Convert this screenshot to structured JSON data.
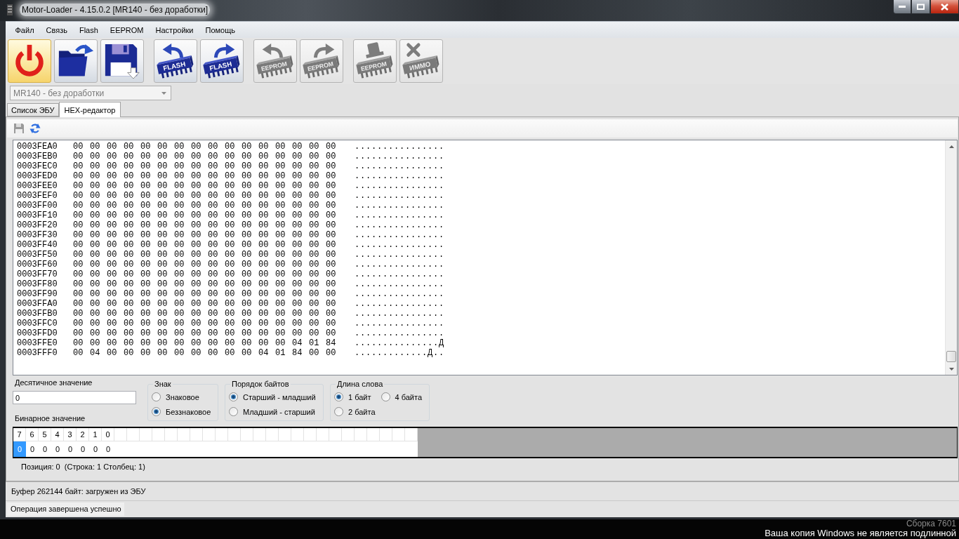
{
  "window": {
    "title": "Motor-Loader - 4.15.0.2 [MR140 - без доработки]"
  },
  "menu": [
    "Файл",
    "Связь",
    "Flash",
    "EEPROM",
    "Настройки",
    "Помощь"
  ],
  "toolbar": [
    [
      {
        "kind": "power",
        "highlighted": true,
        "disabled": false
      },
      {
        "kind": "open",
        "highlighted": false,
        "disabled": false
      },
      {
        "kind": "save",
        "highlighted": false,
        "disabled": false
      }
    ],
    [
      {
        "kind": "chip-read",
        "chip_label": "FLASH",
        "highlighted": false,
        "disabled": false
      },
      {
        "kind": "chip-write",
        "chip_label": "FLASH",
        "highlighted": false,
        "disabled": false
      }
    ],
    [
      {
        "kind": "chip-read",
        "chip_label": "EEPROM",
        "highlighted": false,
        "disabled": true
      },
      {
        "kind": "chip-write",
        "chip_label": "EEPROM",
        "highlighted": false,
        "disabled": true
      }
    ],
    [
      {
        "kind": "chip-stamp",
        "chip_label": "EEPROM",
        "highlighted": false,
        "disabled": true
      },
      {
        "kind": "chip-cross",
        "chip_label": "ИММО",
        "highlighted": false,
        "disabled": true
      }
    ]
  ],
  "ecu_select": {
    "value": "MR140 - без доработки",
    "disabled": true
  },
  "tabs": [
    {
      "label": "Список ЭБУ",
      "selected": false
    },
    {
      "label": "HEX-редактор",
      "selected": true
    }
  ],
  "editor_toolbar": [
    {
      "kind": "save",
      "disabled": true
    },
    {
      "kind": "refresh",
      "disabled": false
    }
  ],
  "hex_view": {
    "rows": [
      {
        "address": "0003FEA0",
        "bytes": "00 00 00 00 00 00 00 00 00 00 00 00 00 00 00 00",
        "ascii": "................"
      },
      {
        "address": "0003FEB0",
        "bytes": "00 00 00 00 00 00 00 00 00 00 00 00 00 00 00 00",
        "ascii": "................"
      },
      {
        "address": "0003FEC0",
        "bytes": "00 00 00 00 00 00 00 00 00 00 00 00 00 00 00 00",
        "ascii": "................"
      },
      {
        "address": "0003FED0",
        "bytes": "00 00 00 00 00 00 00 00 00 00 00 00 00 00 00 00",
        "ascii": "................"
      },
      {
        "address": "0003FEE0",
        "bytes": "00 00 00 00 00 00 00 00 00 00 00 00 00 00 00 00",
        "ascii": "................"
      },
      {
        "address": "0003FEF0",
        "bytes": "00 00 00 00 00 00 00 00 00 00 00 00 00 00 00 00",
        "ascii": "................"
      },
      {
        "address": "0003FF00",
        "bytes": "00 00 00 00 00 00 00 00 00 00 00 00 00 00 00 00",
        "ascii": "................"
      },
      {
        "address": "0003FF10",
        "bytes": "00 00 00 00 00 00 00 00 00 00 00 00 00 00 00 00",
        "ascii": "................"
      },
      {
        "address": "0003FF20",
        "bytes": "00 00 00 00 00 00 00 00 00 00 00 00 00 00 00 00",
        "ascii": "................"
      },
      {
        "address": "0003FF30",
        "bytes": "00 00 00 00 00 00 00 00 00 00 00 00 00 00 00 00",
        "ascii": "................"
      },
      {
        "address": "0003FF40",
        "bytes": "00 00 00 00 00 00 00 00 00 00 00 00 00 00 00 00",
        "ascii": "................"
      },
      {
        "address": "0003FF50",
        "bytes": "00 00 00 00 00 00 00 00 00 00 00 00 00 00 00 00",
        "ascii": "................"
      },
      {
        "address": "0003FF60",
        "bytes": "00 00 00 00 00 00 00 00 00 00 00 00 00 00 00 00",
        "ascii": "................"
      },
      {
        "address": "0003FF70",
        "bytes": "00 00 00 00 00 00 00 00 00 00 00 00 00 00 00 00",
        "ascii": "................"
      },
      {
        "address": "0003FF80",
        "bytes": "00 00 00 00 00 00 00 00 00 00 00 00 00 00 00 00",
        "ascii": "................"
      },
      {
        "address": "0003FF90",
        "bytes": "00 00 00 00 00 00 00 00 00 00 00 00 00 00 00 00",
        "ascii": "................"
      },
      {
        "address": "0003FFA0",
        "bytes": "00 00 00 00 00 00 00 00 00 00 00 00 00 00 00 00",
        "ascii": "................"
      },
      {
        "address": "0003FFB0",
        "bytes": "00 00 00 00 00 00 00 00 00 00 00 00 00 00 00 00",
        "ascii": "................"
      },
      {
        "address": "0003FFC0",
        "bytes": "00 00 00 00 00 00 00 00 00 00 00 00 00 00 00 00",
        "ascii": "................"
      },
      {
        "address": "0003FFD0",
        "bytes": "00 00 00 00 00 00 00 00 00 00 00 00 00 00 00 00",
        "ascii": "................"
      },
      {
        "address": "0003FFE0",
        "bytes": "00 00 00 00 00 00 00 00 00 00 00 00 00 04 01 84",
        "ascii": "...............Д"
      },
      {
        "address": "0003FFF0",
        "bytes": "00 04 00 00 00 00 00 00 00 00 00 04 01 84 00 00",
        "ascii": ".............Д.."
      }
    ]
  },
  "value_panel": {
    "decimal": {
      "label": "Десятичное значение",
      "value": "0"
    },
    "option_groups": [
      {
        "title": "Знак",
        "rows": [
          [
            {
              "label": "Знаковое",
              "selected": false
            }
          ],
          [
            {
              "label": "Беззнаковое",
              "selected": true
            }
          ]
        ]
      },
      {
        "title": "Порядок байтов",
        "rows": [
          [
            {
              "label": "Старший - младший",
              "selected": true
            }
          ],
          [
            {
              "label": "Младший - старший",
              "selected": false
            }
          ]
        ]
      },
      {
        "title": "Длина слова",
        "rows": [
          [
            {
              "label": "1 байт",
              "selected": true
            },
            {
              "label": "4 байта",
              "selected": false
            }
          ],
          [
            {
              "label": "2 байта",
              "selected": false
            }
          ]
        ]
      }
    ],
    "binary": {
      "label": "Бинарное значение",
      "bits": [
        "7",
        "6",
        "5",
        "4",
        "3",
        "2",
        "1",
        "0"
      ],
      "values": [
        {
          "text": "0",
          "selected": true
        },
        {
          "text": "0",
          "selected": false
        },
        {
          "text": "0",
          "selected": false
        },
        {
          "text": "0",
          "selected": false
        },
        {
          "text": "0",
          "selected": false
        },
        {
          "text": "0",
          "selected": false
        },
        {
          "text": "0",
          "selected": false
        },
        {
          "text": "0",
          "selected": false
        }
      ]
    },
    "position": "Позиция: 0  (Строка: 1 Столбец: 1)"
  },
  "buffer_status": "Буфер 262144 байт: загружен из ЭБУ",
  "status_bar": "Операция завершена успешно",
  "desktop_text": [
    "Сборка 7601",
    "Ваша копия Windows не является подлинной"
  ]
}
